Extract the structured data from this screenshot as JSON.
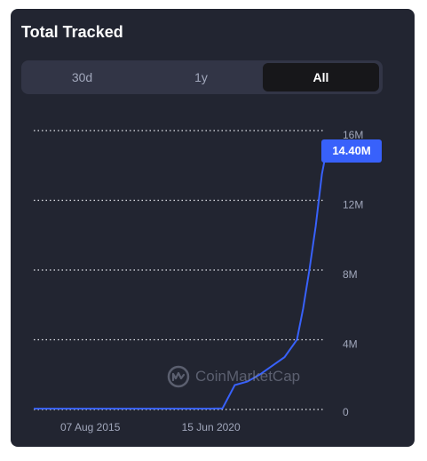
{
  "card": {
    "title": "Total Tracked"
  },
  "tabs": [
    {
      "label": "30d",
      "active": false
    },
    {
      "label": "1y",
      "active": false
    },
    {
      "label": "All",
      "active": true
    }
  ],
  "badge": {
    "value_label": "14.40M"
  },
  "watermark": {
    "text": "CoinMarketCap",
    "icon": "coinmarketcap-logo-icon"
  },
  "colors": {
    "card_bg": "#222531",
    "line": "#3861fb",
    "badge_bg": "#3861fb",
    "tick_text": "#a1a7bb"
  },
  "chart_data": {
    "type": "line",
    "title": "",
    "xlabel": "",
    "ylabel": "",
    "x_tick_labels": [
      "07 Aug 2015",
      "15 Jun 2020"
    ],
    "y_tick_labels": [
      "0",
      "4M",
      "8M",
      "12M",
      "16M"
    ],
    "y_ticks": [
      0,
      4000000,
      8000000,
      12000000,
      16000000
    ],
    "ylim": [
      0,
      16000000
    ],
    "grid": true,
    "last_value_label": "14.40M",
    "series": [
      {
        "values_description_free": true,
        "x": [
          "2013-04-28",
          "2014-06-01",
          "2015-08-07",
          "2016-09-01",
          "2017-10-01",
          "2018-12-01",
          "2019-12-01",
          "2020-06-15",
          "2020-12-01",
          "2021-06-01",
          "2021-12-01",
          "2022-06-01",
          "2022-12-01",
          "2023-06-01",
          "2023-12-01",
          "2024-03-01",
          "2024-06-01",
          "2024-09-01",
          "2024-12-01",
          "2025-01-15"
        ],
        "y": [
          50000,
          50000,
          50000,
          50000,
          50000,
          50000,
          50000,
          50000,
          60000,
          1400000,
          1600000,
          2000000,
          2500000,
          3000000,
          4000000,
          5800000,
          8000000,
          10500000,
          13500000,
          14400000
        ]
      }
    ]
  }
}
